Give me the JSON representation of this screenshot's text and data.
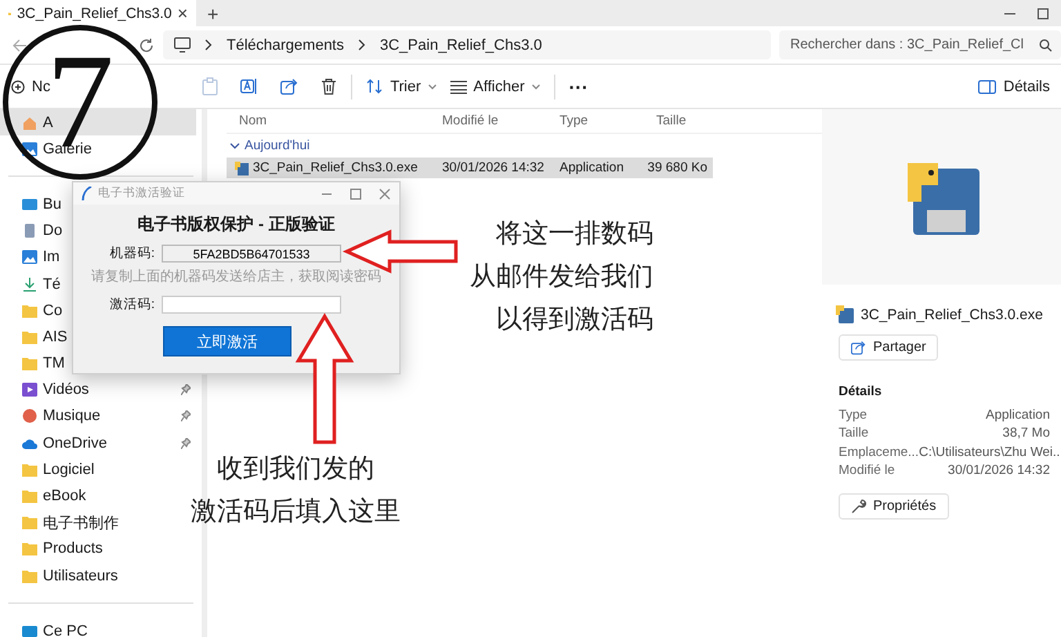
{
  "window": {
    "tab_title": "3C_Pain_Relief_Chs3.0",
    "tab_close": "×",
    "new_tab": "+"
  },
  "address": {
    "breadcrumb": [
      "Téléchargements",
      "3C_Pain_Relief_Chs3.0"
    ],
    "search_placeholder": "Rechercher dans : 3C_Pain_Relief_Cl"
  },
  "toolbar": {
    "new_label": "Nc",
    "sort_label": "Trier",
    "view_label": "Afficher",
    "more": "···",
    "details_label": "Détails"
  },
  "sidebar": {
    "groups": [
      [
        {
          "label": "A",
          "kind": "home",
          "pinned": false,
          "selected": true
        },
        {
          "label": "Galerie",
          "kind": "gallery",
          "pinned": false,
          "selected": false
        }
      ],
      [
        {
          "label": "Bu",
          "kind": "desktop",
          "selected": false
        },
        {
          "label": "Do",
          "kind": "documents",
          "selected": false
        },
        {
          "label": "Im",
          "kind": "images",
          "selected": false
        },
        {
          "label": "Té",
          "kind": "downloads",
          "selected": false
        },
        {
          "label": "Co",
          "kind": "folder",
          "selected": false
        },
        {
          "label": "AIS",
          "kind": "folder",
          "selected": false
        },
        {
          "label": "TM",
          "kind": "folder",
          "selected": false
        },
        {
          "label": "Vidéos",
          "kind": "videos",
          "pinned": true,
          "selected": false
        },
        {
          "label": "Musique",
          "kind": "music",
          "pinned": true,
          "selected": false
        },
        {
          "label": "OneDrive",
          "kind": "cloud",
          "pinned": true,
          "selected": false
        },
        {
          "label": "Logiciel",
          "kind": "folder",
          "pinned": false,
          "selected": false
        },
        {
          "label": "eBook",
          "kind": "folder",
          "pinned": false,
          "selected": false
        },
        {
          "label": "电子书制作",
          "kind": "folder",
          "pinned": false,
          "selected": false
        },
        {
          "label": "Products",
          "kind": "folder",
          "pinned": false,
          "selected": false
        },
        {
          "label": "Utilisateurs",
          "kind": "folder",
          "pinned": false,
          "selected": false
        }
      ],
      [
        {
          "label": "Ce PC",
          "kind": "pc",
          "pinned": false,
          "selected": false
        }
      ]
    ]
  },
  "file_list": {
    "columns": [
      "Nom",
      "Modifié le",
      "Type",
      "Taille"
    ],
    "groups": [
      {
        "label": "Aujourd'hui",
        "expanded": true,
        "rows": [
          {
            "name": "3C_Pain_Relief_Chs3.0.exe",
            "modified": "30/01/2026 14:32",
            "type": "Application",
            "size": "39 680 Ko",
            "selected": true
          }
        ]
      }
    ]
  },
  "details_pane": {
    "file_name": "3C_Pain_Relief_Chs3.0.exe",
    "share_label": "Partager",
    "section_title": "Détails",
    "properties": [
      {
        "label": "Type",
        "value": "Application"
      },
      {
        "label": "Taille",
        "value": "38,7 Mo"
      },
      {
        "label": "Emplaceme...",
        "value": "C:\\Utilisateurs\\Zhu Wei..."
      },
      {
        "label": "Modifié le",
        "value": "30/01/2026 14:32"
      }
    ],
    "properties_button": "Propriétés"
  },
  "dialog": {
    "title": "电子书激活验证",
    "heading": "电子书版权保护 - 正版验证",
    "machine_code_label": "机器码:",
    "machine_code": "5FA2BD5B64701533",
    "hint": "请复制上面的机器码发送给店主，获取阅读密码",
    "activation_label": "激活码:",
    "activate_button": "立即激活"
  },
  "annotations": {
    "step_number": "7",
    "notes": [
      {
        "lines": [
          "将这一排数码",
          "从邮件发给我们",
          "以得到激活码"
        ]
      },
      {
        "lines": [
          "收到我们发的",
          "激活码后填入这里"
        ]
      }
    ]
  }
}
